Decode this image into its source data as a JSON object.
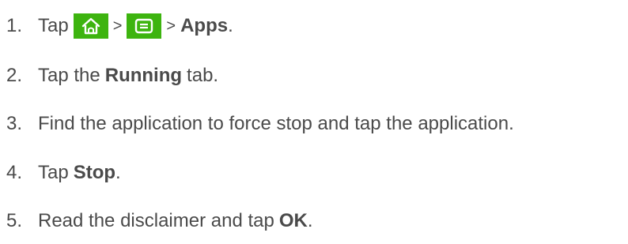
{
  "steps": [
    {
      "number": "1.",
      "prefix": "Tap",
      "icons": [
        "home-icon",
        "menu-icon"
      ],
      "separator": ">",
      "bold": "Apps",
      "suffix": "."
    },
    {
      "number": "2.",
      "prefix": "Tap the",
      "bold": "Running",
      "suffix": "tab."
    },
    {
      "number": "3.",
      "text": "Find the application to force stop and tap the application."
    },
    {
      "number": "4.",
      "prefix": "Tap",
      "bold": "Stop",
      "suffix": "."
    },
    {
      "number": "5.",
      "prefix": "Read the disclaimer and tap",
      "bold": "OK",
      "suffix": "."
    }
  ],
  "colors": {
    "text": "#4a4a4a",
    "icon_background": "#3db40f",
    "icon_glyph": "#ffffff"
  }
}
